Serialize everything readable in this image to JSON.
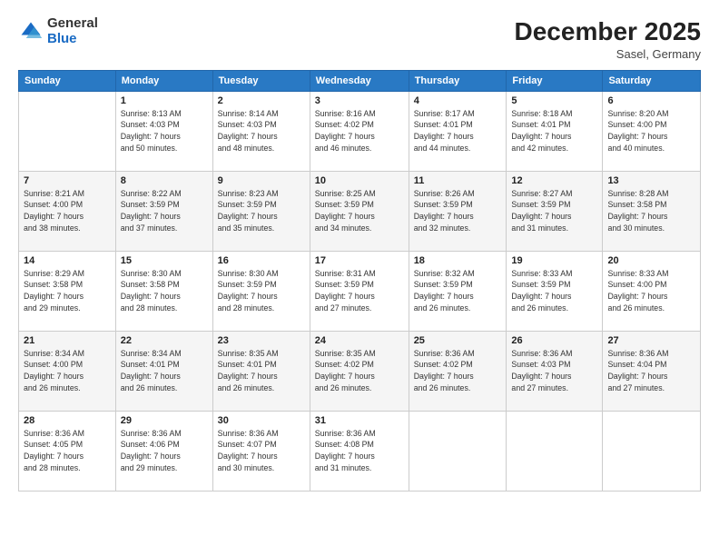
{
  "logo": {
    "general": "General",
    "blue": "Blue"
  },
  "title": "December 2025",
  "location": "Sasel, Germany",
  "days_of_week": [
    "Sunday",
    "Monday",
    "Tuesday",
    "Wednesday",
    "Thursday",
    "Friday",
    "Saturday"
  ],
  "weeks": [
    [
      {
        "day": "",
        "info": ""
      },
      {
        "day": "1",
        "info": "Sunrise: 8:13 AM\nSunset: 4:03 PM\nDaylight: 7 hours\nand 50 minutes."
      },
      {
        "day": "2",
        "info": "Sunrise: 8:14 AM\nSunset: 4:03 PM\nDaylight: 7 hours\nand 48 minutes."
      },
      {
        "day": "3",
        "info": "Sunrise: 8:16 AM\nSunset: 4:02 PM\nDaylight: 7 hours\nand 46 minutes."
      },
      {
        "day": "4",
        "info": "Sunrise: 8:17 AM\nSunset: 4:01 PM\nDaylight: 7 hours\nand 44 minutes."
      },
      {
        "day": "5",
        "info": "Sunrise: 8:18 AM\nSunset: 4:01 PM\nDaylight: 7 hours\nand 42 minutes."
      },
      {
        "day": "6",
        "info": "Sunrise: 8:20 AM\nSunset: 4:00 PM\nDaylight: 7 hours\nand 40 minutes."
      }
    ],
    [
      {
        "day": "7",
        "info": "Sunrise: 8:21 AM\nSunset: 4:00 PM\nDaylight: 7 hours\nand 38 minutes."
      },
      {
        "day": "8",
        "info": "Sunrise: 8:22 AM\nSunset: 3:59 PM\nDaylight: 7 hours\nand 37 minutes."
      },
      {
        "day": "9",
        "info": "Sunrise: 8:23 AM\nSunset: 3:59 PM\nDaylight: 7 hours\nand 35 minutes."
      },
      {
        "day": "10",
        "info": "Sunrise: 8:25 AM\nSunset: 3:59 PM\nDaylight: 7 hours\nand 34 minutes."
      },
      {
        "day": "11",
        "info": "Sunrise: 8:26 AM\nSunset: 3:59 PM\nDaylight: 7 hours\nand 32 minutes."
      },
      {
        "day": "12",
        "info": "Sunrise: 8:27 AM\nSunset: 3:59 PM\nDaylight: 7 hours\nand 31 minutes."
      },
      {
        "day": "13",
        "info": "Sunrise: 8:28 AM\nSunset: 3:58 PM\nDaylight: 7 hours\nand 30 minutes."
      }
    ],
    [
      {
        "day": "14",
        "info": "Sunrise: 8:29 AM\nSunset: 3:58 PM\nDaylight: 7 hours\nand 29 minutes."
      },
      {
        "day": "15",
        "info": "Sunrise: 8:30 AM\nSunset: 3:58 PM\nDaylight: 7 hours\nand 28 minutes."
      },
      {
        "day": "16",
        "info": "Sunrise: 8:30 AM\nSunset: 3:59 PM\nDaylight: 7 hours\nand 28 minutes."
      },
      {
        "day": "17",
        "info": "Sunrise: 8:31 AM\nSunset: 3:59 PM\nDaylight: 7 hours\nand 27 minutes."
      },
      {
        "day": "18",
        "info": "Sunrise: 8:32 AM\nSunset: 3:59 PM\nDaylight: 7 hours\nand 26 minutes."
      },
      {
        "day": "19",
        "info": "Sunrise: 8:33 AM\nSunset: 3:59 PM\nDaylight: 7 hours\nand 26 minutes."
      },
      {
        "day": "20",
        "info": "Sunrise: 8:33 AM\nSunset: 4:00 PM\nDaylight: 7 hours\nand 26 minutes."
      }
    ],
    [
      {
        "day": "21",
        "info": "Sunrise: 8:34 AM\nSunset: 4:00 PM\nDaylight: 7 hours\nand 26 minutes."
      },
      {
        "day": "22",
        "info": "Sunrise: 8:34 AM\nSunset: 4:01 PM\nDaylight: 7 hours\nand 26 minutes."
      },
      {
        "day": "23",
        "info": "Sunrise: 8:35 AM\nSunset: 4:01 PM\nDaylight: 7 hours\nand 26 minutes."
      },
      {
        "day": "24",
        "info": "Sunrise: 8:35 AM\nSunset: 4:02 PM\nDaylight: 7 hours\nand 26 minutes."
      },
      {
        "day": "25",
        "info": "Sunrise: 8:36 AM\nSunset: 4:02 PM\nDaylight: 7 hours\nand 26 minutes."
      },
      {
        "day": "26",
        "info": "Sunrise: 8:36 AM\nSunset: 4:03 PM\nDaylight: 7 hours\nand 27 minutes."
      },
      {
        "day": "27",
        "info": "Sunrise: 8:36 AM\nSunset: 4:04 PM\nDaylight: 7 hours\nand 27 minutes."
      }
    ],
    [
      {
        "day": "28",
        "info": "Sunrise: 8:36 AM\nSunset: 4:05 PM\nDaylight: 7 hours\nand 28 minutes."
      },
      {
        "day": "29",
        "info": "Sunrise: 8:36 AM\nSunset: 4:06 PM\nDaylight: 7 hours\nand 29 minutes."
      },
      {
        "day": "30",
        "info": "Sunrise: 8:36 AM\nSunset: 4:07 PM\nDaylight: 7 hours\nand 30 minutes."
      },
      {
        "day": "31",
        "info": "Sunrise: 8:36 AM\nSunset: 4:08 PM\nDaylight: 7 hours\nand 31 minutes."
      },
      {
        "day": "",
        "info": ""
      },
      {
        "day": "",
        "info": ""
      },
      {
        "day": "",
        "info": ""
      }
    ]
  ]
}
